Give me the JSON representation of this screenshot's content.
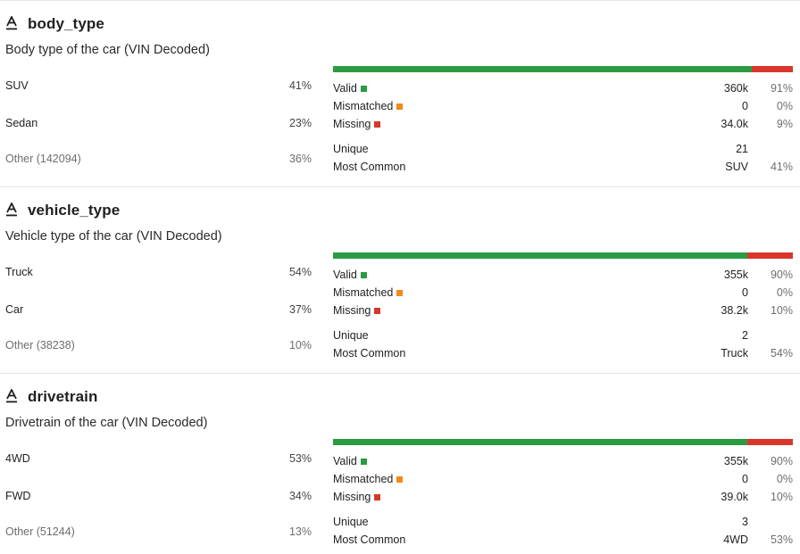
{
  "colors": {
    "valid": "#2c9a43",
    "mismatched": "#f08a1c",
    "missing": "#d9362b",
    "icon": "text-type-icon"
  },
  "columns": [
    {
      "name": "body_type",
      "description": "Body type of the car (VIN Decoded)",
      "categories": [
        {
          "label": "SUV",
          "pct": "41%"
        },
        {
          "label": "Sedan",
          "pct": "23%"
        },
        {
          "label": "Other (142094)",
          "pct": "36%"
        }
      ],
      "quality": {
        "valid": 0.91,
        "mismatched": 0.0,
        "missing": 0.09
      },
      "stats": {
        "valid": {
          "label": "Valid",
          "value": "360k",
          "pct": "91%"
        },
        "mismatched": {
          "label": "Mismatched",
          "value": "0",
          "pct": "0%"
        },
        "missing": {
          "label": "Missing",
          "value": "34.0k",
          "pct": "9%"
        },
        "unique": {
          "label": "Unique",
          "value": "21"
        },
        "most_common": {
          "label": "Most Common",
          "value": "SUV",
          "pct": "41%"
        }
      }
    },
    {
      "name": "vehicle_type",
      "description": "Vehicle type of the car (VIN Decoded)",
      "categories": [
        {
          "label": "Truck",
          "pct": "54%"
        },
        {
          "label": "Car",
          "pct": "37%"
        },
        {
          "label": "Other (38238)",
          "pct": "10%"
        }
      ],
      "quality": {
        "valid": 0.9,
        "mismatched": 0.0,
        "missing": 0.1
      },
      "stats": {
        "valid": {
          "label": "Valid",
          "value": "355k",
          "pct": "90%"
        },
        "mismatched": {
          "label": "Mismatched",
          "value": "0",
          "pct": "0%"
        },
        "missing": {
          "label": "Missing",
          "value": "38.2k",
          "pct": "10%"
        },
        "unique": {
          "label": "Unique",
          "value": "2"
        },
        "most_common": {
          "label": "Most Common",
          "value": "Truck",
          "pct": "54%"
        }
      }
    },
    {
      "name": "drivetrain",
      "description": "Drivetrain of the car (VIN Decoded)",
      "categories": [
        {
          "label": "4WD",
          "pct": "53%"
        },
        {
          "label": "FWD",
          "pct": "34%"
        },
        {
          "label": "Other (51244)",
          "pct": "13%"
        }
      ],
      "quality": {
        "valid": 0.9,
        "mismatched": 0.0,
        "missing": 0.1
      },
      "stats": {
        "valid": {
          "label": "Valid",
          "value": "355k",
          "pct": "90%"
        },
        "mismatched": {
          "label": "Mismatched",
          "value": "0",
          "pct": "0%"
        },
        "missing": {
          "label": "Missing",
          "value": "39.0k",
          "pct": "10%"
        },
        "unique": {
          "label": "Unique",
          "value": "3"
        },
        "most_common": {
          "label": "Most Common",
          "value": "4WD",
          "pct": "53%"
        }
      }
    }
  ]
}
